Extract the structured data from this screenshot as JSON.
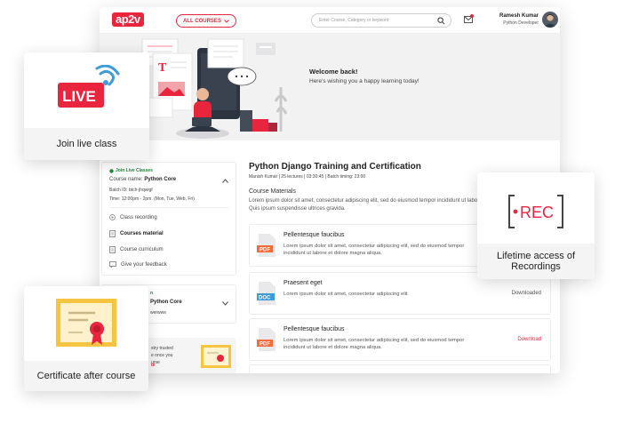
{
  "header": {
    "logo": "ap2v",
    "all_courses": "ALL COURSES",
    "search_placeholder": "Enter Course, Category or keyword",
    "user_name": "Ramesh Kumar",
    "user_role": "Python Developer"
  },
  "hero": {
    "welcome_title": "Welcome back!",
    "welcome_subtitle": "Here's wishing you a happy learning today!"
  },
  "sidebar": {
    "live_tag": "Join Live Classes",
    "course_label": "Course name:",
    "course_name": "Python Core",
    "batch_id": "Batch ID: btch-jhqwigf",
    "timing": "Time: 12:00pm - 2pm. (Mon, Tue, Web, Fri)",
    "menu": [
      {
        "label": "Class recording",
        "icon": "video-icon"
      },
      {
        "label": "Courses material",
        "icon": "document-icon"
      },
      {
        "label": "Course curriculum",
        "icon": "document-icon"
      },
      {
        "label": "Give your feedback",
        "icon": "feedback-icon"
      }
    ],
    "second": {
      "tag": "n",
      "course_name": "Python Core",
      "batch": "werwwe"
    },
    "promo": {
      "line1": "stry trusted",
      "line2": "e once you",
      "line3": "urse",
      "link": "te"
    }
  },
  "course": {
    "title": "Python Django Training and Certification",
    "meta": "Manish Kumar | 25 lectures | 03:30:45 | Batch timing: 23:00",
    "materials_heading": "Course Materials",
    "materials_desc": "Lorem ipsum dolor sit amet, consectetur adipiscing elit, sed do eiusmod tempor incididunt ut labore et dolore magna aliqua. Quis ipsum suspendisse ultrices gravida.",
    "materials": [
      {
        "type": "PDF",
        "title": "Pellentesque faucibus",
        "desc": "Lorem ipsum dolor sit amet, consectetur adipiscing elit, sed do eiusmod tempor incididunt ut labore et dolore magna aliqua.",
        "status": ""
      },
      {
        "type": "DOC",
        "title": "Praesent eget",
        "desc": "Lorem ipsum dolor sit amet, consectetur adipiscing elit",
        "status": "Downloaded"
      },
      {
        "type": "PDF",
        "title": "Pellentesque faucibus",
        "desc": "Lorem ipsum dolor sit amet, consectetur adipiscing elit, sed do eiusmod tempor incididunt ut labore et dolore magna aliqua.",
        "status": "Download"
      }
    ]
  },
  "cards": {
    "live_badge": "LIVE",
    "live_label": "Join live class",
    "rec_badge": "REC",
    "rec_label": "Lifetime access of Recordings",
    "cert_label": "Certificate after course"
  },
  "colors": {
    "brand": "#e8253c",
    "pdf": "#f36b3b",
    "doc": "#3d9bd8",
    "live_green": "#1b8a3a",
    "certificate": "#f5c542"
  }
}
